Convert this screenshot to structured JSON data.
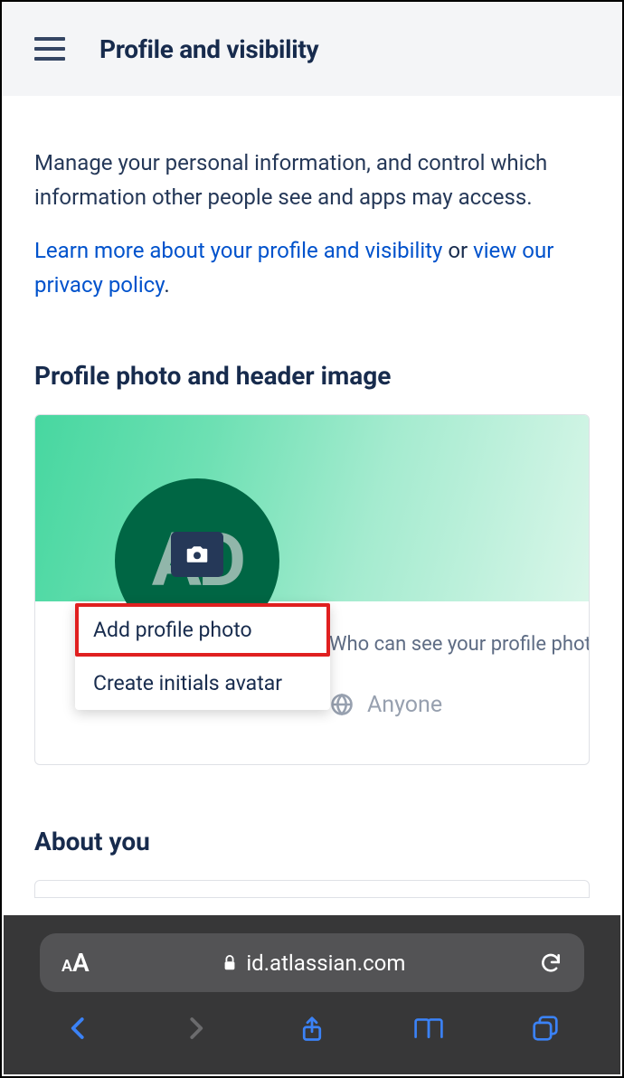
{
  "header": {
    "title": "Profile and visibility"
  },
  "intro": {
    "text": "Manage your personal information, and control which information other people see and apps may access."
  },
  "links": {
    "learn_more": "Learn more about your profile and visibility",
    "or": " or ",
    "privacy": "view our privacy policy",
    "period": "."
  },
  "sections": {
    "photo_title": "Profile photo and header image",
    "about_title": "About you"
  },
  "avatar": {
    "initials": "AD"
  },
  "dropdown": {
    "add_photo": "Add profile photo",
    "create_initials": "Create initials avatar"
  },
  "visibility": {
    "label": "Who can see your profile photo?",
    "value": "Anyone"
  },
  "browser": {
    "url": "id.atlassian.com"
  }
}
